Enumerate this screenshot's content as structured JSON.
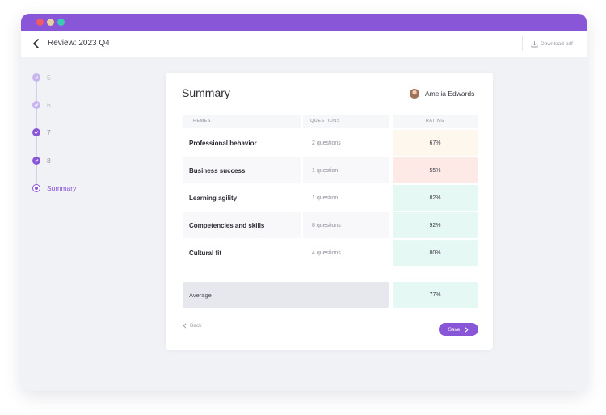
{
  "header": {
    "title": "Review: 2023 Q4",
    "download_label": "Download pdf"
  },
  "stepper": {
    "steps": [
      {
        "label": "5",
        "state": "done-faded"
      },
      {
        "label": "6",
        "state": "done-faded"
      },
      {
        "label": "7",
        "state": "done"
      },
      {
        "label": "8",
        "state": "done"
      },
      {
        "label": "Summary",
        "state": "current"
      }
    ]
  },
  "card": {
    "title": "Summary",
    "user_name": "Amelia Edwards",
    "columns": {
      "themes": "THEMES",
      "questions": "QUESTIONS",
      "rating": "RATING"
    },
    "rows": [
      {
        "theme": "Professional behavior",
        "questions": "2 questions",
        "rating": "67%",
        "rating_color": "#fdf7ee"
      },
      {
        "theme": "Business success",
        "questions": "1 question",
        "rating": "55%",
        "rating_color": "#fdeae6"
      },
      {
        "theme": "Learning agility",
        "questions": "1 question",
        "rating": "82%",
        "rating_color": "#e6f8f4"
      },
      {
        "theme": "Competencies and skills",
        "questions": "8 questions",
        "rating": "92%",
        "rating_color": "#e6f8f4"
      },
      {
        "theme": "Cultural fit",
        "questions": "4 questions",
        "rating": "80%",
        "rating_color": "#e6f8f4"
      }
    ],
    "average_label": "Average",
    "average_value": "77%",
    "average_color": "#e6f8f4",
    "back_label": "Back",
    "save_label": "Save"
  },
  "colors": {
    "accent": "#8a56d8",
    "titlebar": "#8a56d8",
    "traffic_red": "#ee5a67",
    "traffic_yellow": "#e8d19a",
    "traffic_green": "#3ec9b2"
  }
}
